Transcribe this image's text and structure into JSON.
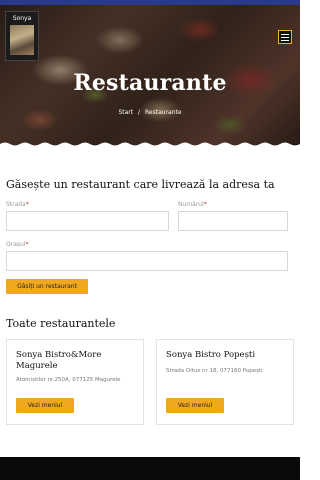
{
  "header": {
    "logo_text": "Sonya",
    "title": "Restaurante",
    "breadcrumb": [
      {
        "label": "Start"
      },
      {
        "label": "Restaurante"
      }
    ],
    "breadcrumb_separator": "/"
  },
  "search": {
    "heading": "Găsește un restaurant care livrează la adresa ta",
    "street_label": "Strada",
    "number_label": "Numărul",
    "city_label": "Orașul",
    "required_mark": "*",
    "button_label": "Găsiți un restaurant"
  },
  "restaurants": {
    "heading": "Toate restaurantele",
    "items": [
      {
        "name": "Sonya Bistro&More Magurele",
        "address": "Atomiștilor nr.250A, 077125 Magurele",
        "button": "Vezi meniul"
      },
      {
        "name": "Sonya Bistro Popești",
        "address": "Strada Oituz nr 18, 077160 Popești",
        "button": "Vezi meniul"
      }
    ]
  },
  "colors": {
    "accent": "#f0a820",
    "top_bar": "#2a3a8a",
    "footer": "#0a0a0a"
  }
}
